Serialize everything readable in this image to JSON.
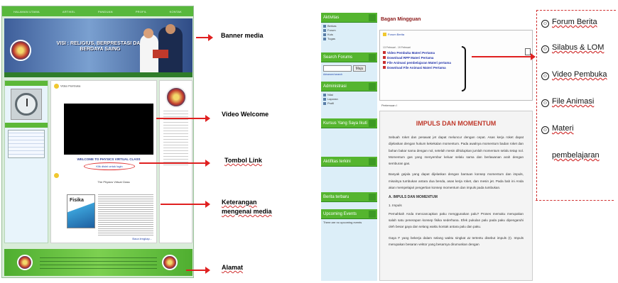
{
  "site": {
    "nav": [
      "HALAMAN UTAMA",
      "ARTIKEL",
      "PANDUAN",
      "PROFIL",
      "KONTAK"
    ],
    "banner_text": "VISI : RELIGIUS, BERPRESTASI DAN BERDAYA SAING",
    "video_post_title": "Video Pembuka",
    "welcome_text": "WELCOME TO PHYSICS VIRTUAL CLASS",
    "link_text": "Klik disini untuk login",
    "book_post_title": "The Physics Virtual Class",
    "book_cover_text": "Fisika",
    "more_link": "Baca lengkap..."
  },
  "annotations_left": {
    "banner": "Banner media",
    "video": "Video Welcome",
    "link_button": "Tombol Link",
    "description_line1": "Keterangan",
    "description_line2": "mengenai media",
    "address": "Alamat"
  },
  "moodle": {
    "sidebar": {
      "activities_title": "Aktivitas",
      "activities_items": [
        "Berkas",
        "Forum",
        "Kuis",
        "Tugas"
      ],
      "search_title": "Search Forums",
      "search_button": "Maju",
      "advanced_search": "Advanced search",
      "admin_title": "Administrasi",
      "admin_items": [
        "Nilai",
        "Laporan",
        "Profil"
      ],
      "courses_title": "Kursus Yang Saya Ikuti",
      "news_title": "Aktifitas terkini",
      "latest_title": "Berita terbaru",
      "events_title": "Upcoming Events",
      "events_text": "There are no upcoming events"
    },
    "weekly_title": "Bagan Mingguan",
    "forum_link": "Forum Berita",
    "date_range": "13 Februari - 19 Februari",
    "links": [
      "Video Pembuka Materi Pertama",
      "Download RPP Materi Pertama",
      "File Animasi pembelajaran Materi pertama",
      "Download File Animasi Materi Pertama"
    ],
    "strip_label": "Pertemuan I",
    "article_title": "IMPULS DAN MOMENTUM",
    "para1": "Sebuah roket dan pesawat jet dapat meluncur dengan cepat. Asas kerja roket dapat dijelaskan dengan hukum kekekalan momentum. Pada awalnya momentum badan roket dan bahan bakar sama dengan nol, setelah mesin dihidupkan jumlah momentum selalu tetap nol. Momentum gas yang menyembur keluar selalu sama dan berlawanan arah dengan semburan gas.",
    "para2": "Banyak gejala yang dapat dijelaskan dengan bantuan konsep momentum dan impuls, misalnya tumbukan antara dua benda, asas kerja roket, dan mesin jet. Pada bab ini Anda akan mempelajari pengertian konsep momentum dan impuls pada tumbukan.",
    "section1": "A. IMPULS DAN MOMENTUM",
    "section1_sub": "1. Impuls",
    "para3": "Pernahkah Anda mencancapkan paku menggunakan palu? Proses memaku merupakan salah satu penerapan konsep fisika sederhana. Efek pukulan palu pada paku dipengaruhi oleh besar gaya dan selang waktu kontak antara palu dan paku.",
    "para4": "Gaya F yang bekerja dalam selang waktu singkat Δt tertentu disebut impuls (I). Impuls merupakan besaran vektor yang besarnya dirumuskan dengan"
  },
  "legend": [
    "Forum Berita",
    "Silabus & LOM",
    "Video Pembuka",
    "File Animasi",
    "Materi",
    "pembelajaran"
  ],
  "colors": {
    "green": "#55b52f",
    "arrow_red": "#e02020",
    "title_red": "#c0392b"
  }
}
